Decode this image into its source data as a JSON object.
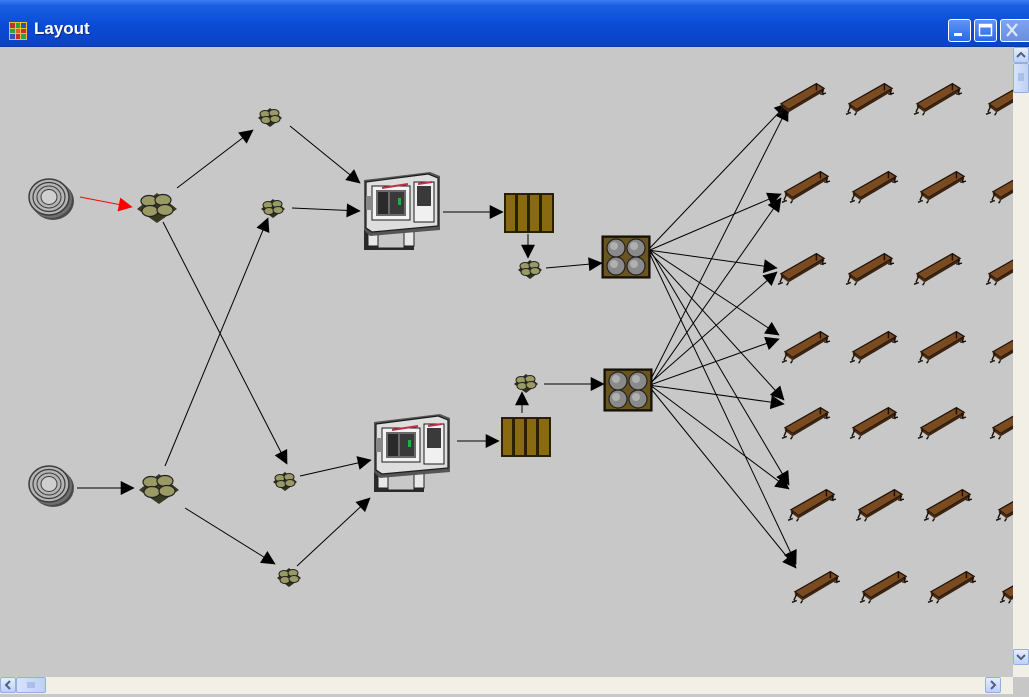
{
  "window": {
    "title": "Layout",
    "icons": {
      "app": "layout-app-icon",
      "minimize": "minimize-icon",
      "maximize": "maximize-icon",
      "close": "close-icon"
    }
  },
  "diagram": {
    "node_types": {
      "source": "source-disc-stack-icon",
      "buffer_large": "buffer-large-icon",
      "buffer_small": "buffer-small-icon",
      "machine": "machine-cnc-icon",
      "conveyor": "conveyor-icon",
      "distributor": "distributor-icon",
      "bench": "workbench-icon"
    },
    "colors": {
      "canvas": "#c8c8c8",
      "arrow": "#000000",
      "highlight_arrow": "#ff0000",
      "bench": "#7a4a20",
      "buffer": "#7d7d4e",
      "conveyor": "#806000"
    }
  },
  "scrollbars": {
    "vertical": "vertical-scrollbar",
    "horizontal": "horizontal-scrollbar"
  }
}
